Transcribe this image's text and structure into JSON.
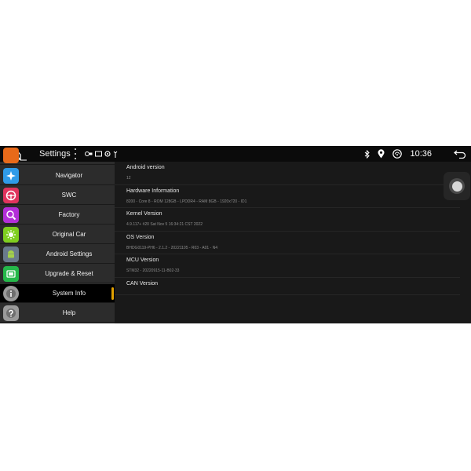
{
  "header": {
    "title": "Settings",
    "time": "10:36",
    "icons": [
      "home-icon",
      "menu-dots-icon",
      "bluetooth-icon",
      "location-icon",
      "wireless-icon",
      "back-icon"
    ]
  },
  "sidebar": {
    "items": [
      {
        "label": "Navigator",
        "icon": "navigator-icon",
        "color": "#2f9be8"
      },
      {
        "label": "SWC",
        "icon": "steering-wheel-icon",
        "color": "#e0345e"
      },
      {
        "label": "Factory",
        "icon": "factory-icon",
        "color": "#b32fd8"
      },
      {
        "label": "Original Car",
        "icon": "original-car-icon",
        "color": "#7fcf1f"
      },
      {
        "label": "Android Settings",
        "icon": "android-icon",
        "color": "#6a7a8c"
      },
      {
        "label": "Upgrade & Reset",
        "icon": "upgrade-icon",
        "color": "#25b84a"
      },
      {
        "label": "System Info",
        "icon": "info-icon",
        "color": "#9a9a9a"
      },
      {
        "label": "Help",
        "icon": "help-icon",
        "color": "#9a9a9a"
      }
    ],
    "active_index": 6
  },
  "info": {
    "rows": [
      {
        "label": "Android version",
        "value": "12"
      },
      {
        "label": "Hardware Information",
        "value": "8200 - Core 8 - ROM 128GB - LPDDR4 - RAM 8GB - 1920x720 - ID1"
      },
      {
        "label": "Kernel Version",
        "value": "4.9.117+ #20 Sat Nov 5 16:34:21 CST 2022"
      },
      {
        "label": "OS Version",
        "value": "BHDG0119-PH6 - 2.1.2 - 20221105 - R03 - A01 - N4"
      },
      {
        "label": "MCU Version",
        "value": "STM32 - 20220915-11-B02-33"
      },
      {
        "label": "CAN Version",
        "value": ""
      }
    ]
  },
  "colors": {
    "background": "#1a1a1a",
    "sidebar": "#2c2c2c",
    "active_item": "#000000",
    "accent": "#e0a000"
  }
}
